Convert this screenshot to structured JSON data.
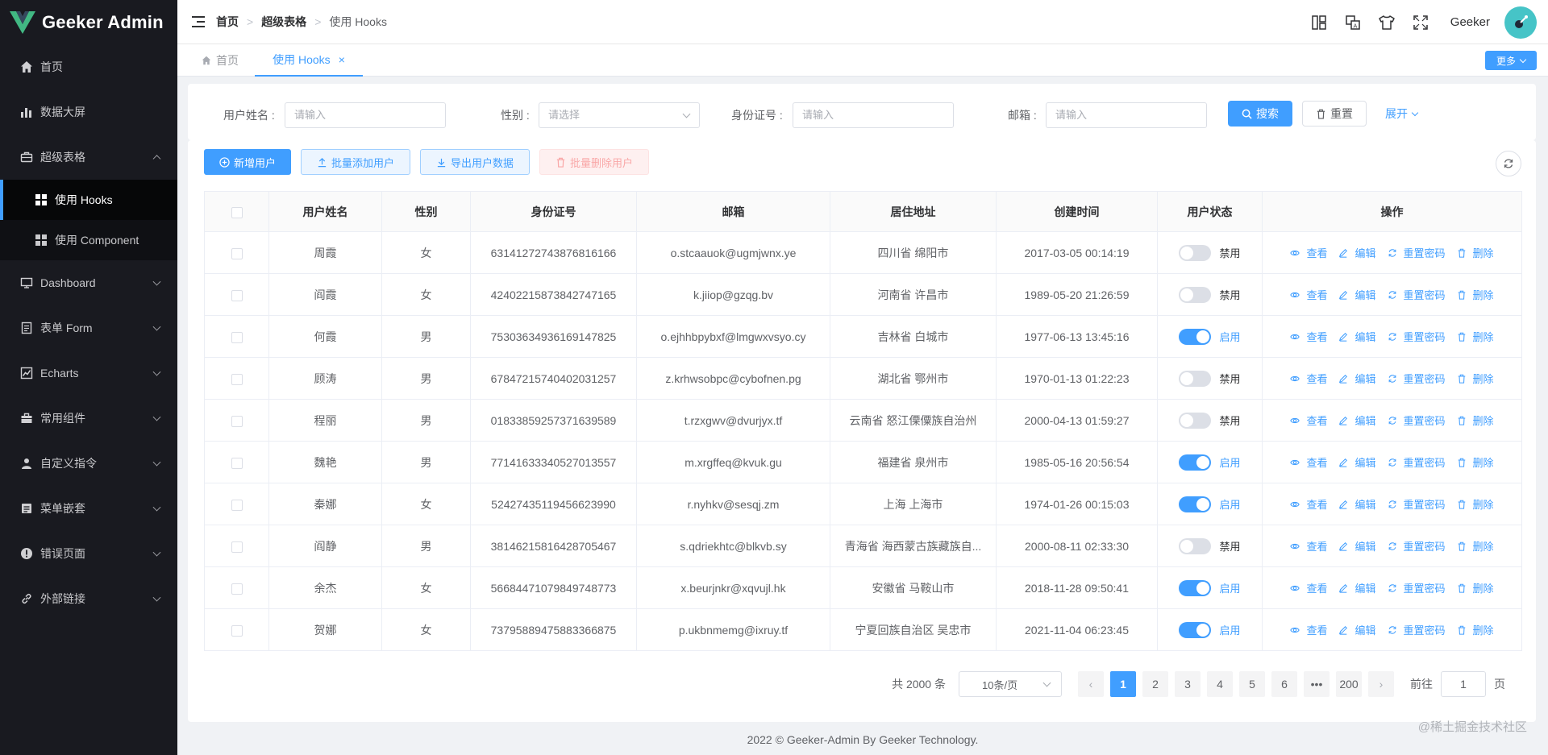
{
  "app": {
    "title": "Geeker Admin",
    "brand_color": "#409eff"
  },
  "sidebar": {
    "items": [
      {
        "label": "首页",
        "icon": "home-icon"
      },
      {
        "label": "数据大屏",
        "icon": "bar-chart-icon"
      },
      {
        "label": "超级表格",
        "icon": "briefcase-icon",
        "expanded": true,
        "children": [
          {
            "label": "使用 Hooks",
            "active": true
          },
          {
            "label": "使用 Component",
            "active": false
          }
        ]
      },
      {
        "label": "Dashboard",
        "icon": "monitor-icon"
      },
      {
        "label": "表单 Form",
        "icon": "form-icon"
      },
      {
        "label": "Echarts",
        "icon": "line-chart-icon"
      },
      {
        "label": "常用组件",
        "icon": "toolbox-icon"
      },
      {
        "label": "自定义指令",
        "icon": "user-icon"
      },
      {
        "label": "菜单嵌套",
        "icon": "menu-icon"
      },
      {
        "label": "错误页面",
        "icon": "warning-icon"
      },
      {
        "label": "外部链接",
        "icon": "link-icon"
      }
    ]
  },
  "header": {
    "breadcrumb": [
      "首页",
      "超级表格",
      "使用 Hooks"
    ],
    "username": "Geeker",
    "icons": [
      "layout-icon",
      "translate-icon",
      "theme-icon",
      "fullscreen-icon"
    ]
  },
  "tabs": {
    "items": [
      {
        "label": "首页",
        "active": false
      },
      {
        "label": "使用 Hooks",
        "active": true
      }
    ],
    "more_label": "更多"
  },
  "search": {
    "username_label": "用户姓名 :",
    "username_placeholder": "请输入",
    "gender_label": "性别 :",
    "gender_placeholder": "请选择",
    "idcard_label": "身份证号 :",
    "idcard_placeholder": "请输入",
    "email_label": "邮箱 :",
    "email_placeholder": "请输入",
    "search_btn": "搜索",
    "reset_btn": "重置",
    "expand_btn": "展开"
  },
  "toolbar": {
    "add_user": "新增用户",
    "batch_add": "批量添加用户",
    "export": "导出用户数据",
    "batch_delete": "批量删除用户"
  },
  "table": {
    "columns": [
      "用户姓名",
      "性别",
      "身份证号",
      "邮箱",
      "居住地址",
      "创建时间",
      "用户状态",
      "操作"
    ],
    "action_labels": {
      "view": "查看",
      "edit": "编辑",
      "reset": "重置密码",
      "delete": "删除"
    },
    "rows": [
      {
        "name": "周霞",
        "gender": "女",
        "idcard": "63141272743876816166",
        "email": "o.stcaauok@ugmjwnx.ye",
        "address": "四川省 绵阳市",
        "created": "2017-03-05 00:14:19",
        "enabled": false,
        "status": "禁用"
      },
      {
        "name": "阎霞",
        "gender": "女",
        "idcard": "42402215873842747165",
        "email": "k.jiiop@gzqg.bv",
        "address": "河南省 许昌市",
        "created": "1989-05-20 21:26:59",
        "enabled": false,
        "status": "禁用"
      },
      {
        "name": "何霞",
        "gender": "男",
        "idcard": "75303634936169147825",
        "email": "o.ejhhbpybxf@lmgwxvsyo.cy",
        "address": "吉林省 白城市",
        "created": "1977-06-13 13:45:16",
        "enabled": true,
        "status": "启用"
      },
      {
        "name": "顾涛",
        "gender": "男",
        "idcard": "67847215740402031257",
        "email": "z.krhwsobpc@cybofnen.pg",
        "address": "湖北省 鄂州市",
        "created": "1970-01-13 01:22:23",
        "enabled": false,
        "status": "禁用"
      },
      {
        "name": "程丽",
        "gender": "男",
        "idcard": "01833859257371639589",
        "email": "t.rzxgwv@dvurjyx.tf",
        "address": "云南省 怒江傈僳族自治州",
        "created": "2000-04-13 01:59:27",
        "enabled": false,
        "status": "禁用"
      },
      {
        "name": "魏艳",
        "gender": "男",
        "idcard": "77141633340527013557",
        "email": "m.xrgffeq@kvuk.gu",
        "address": "福建省 泉州市",
        "created": "1985-05-16 20:56:54",
        "enabled": true,
        "status": "启用"
      },
      {
        "name": "秦娜",
        "gender": "女",
        "idcard": "52427435119456623990",
        "email": "r.nyhkv@sesqj.zm",
        "address": "上海 上海市",
        "created": "1974-01-26 00:15:03",
        "enabled": true,
        "status": "启用"
      },
      {
        "name": "阎静",
        "gender": "男",
        "idcard": "38146215816428705467",
        "email": "s.qdriekhtc@blkvb.sy",
        "address": "青海省 海西蒙古族藏族自...",
        "created": "2000-08-11 02:33:30",
        "enabled": false,
        "status": "禁用"
      },
      {
        "name": "余杰",
        "gender": "女",
        "idcard": "56684471079849748773",
        "email": "x.beurjnkr@xqvujl.hk",
        "address": "安徽省 马鞍山市",
        "created": "2018-11-28 09:50:41",
        "enabled": true,
        "status": "启用"
      },
      {
        "name": "贺娜",
        "gender": "女",
        "idcard": "73795889475883366875",
        "email": "p.ukbnmemg@ixruy.tf",
        "address": "宁夏回族自治区 吴忠市",
        "created": "2021-11-04 06:23:45",
        "enabled": true,
        "status": "启用"
      }
    ]
  },
  "pagination": {
    "total_label": "共 2000 条",
    "page_size": "10条/页",
    "pages": [
      "1",
      "2",
      "3",
      "4",
      "5",
      "6",
      "•••",
      "200"
    ],
    "current": "1",
    "goto_label": "前往",
    "goto_value": "1",
    "goto_unit": "页"
  },
  "footer": {
    "text": "2022 © Geeker-Admin By Geeker Technology."
  },
  "watermark": "@稀土掘金技术社区"
}
